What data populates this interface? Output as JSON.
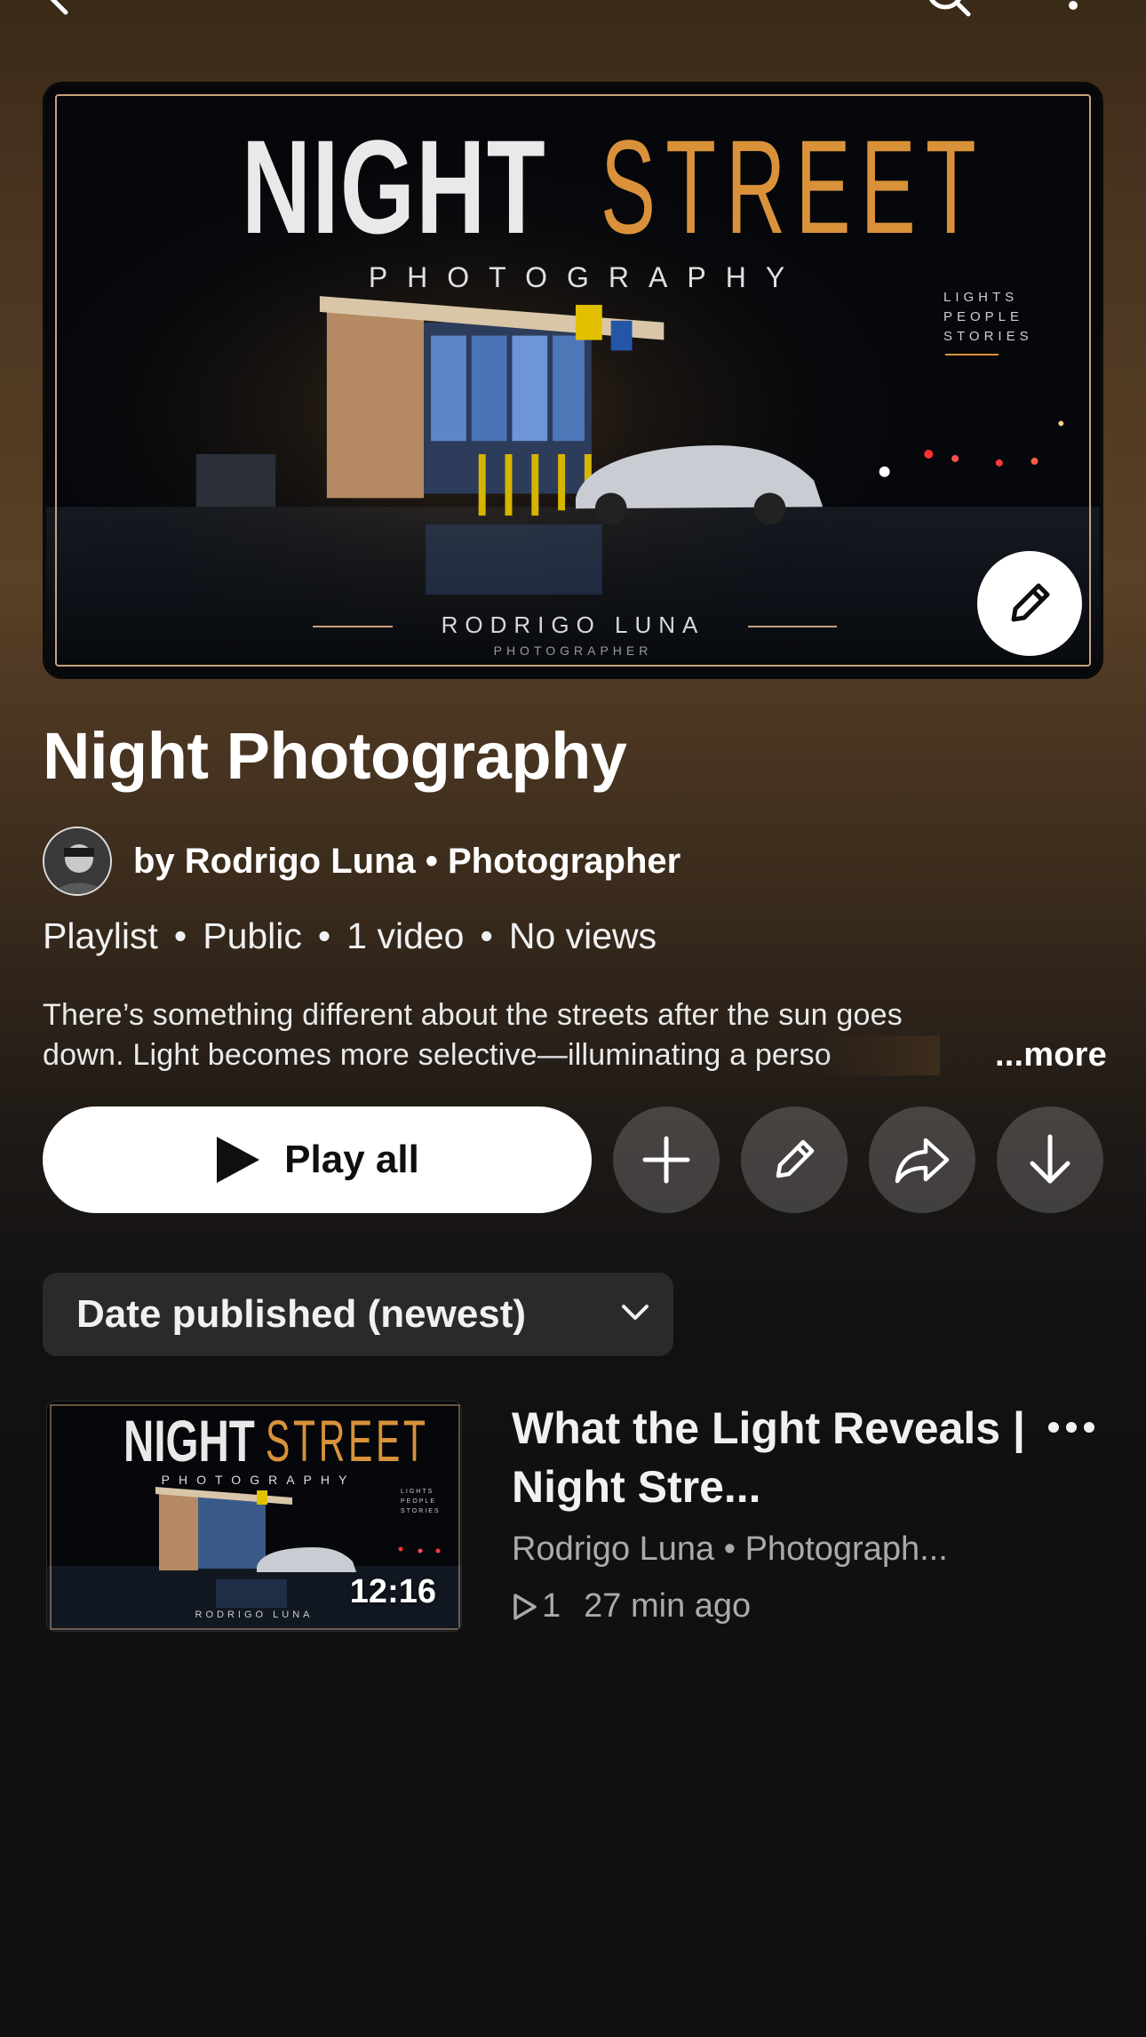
{
  "hero": {
    "title_part1": "NIGHT",
    "title_part2": "STREET",
    "subtitle": "PHOTOGRAPHY",
    "tagline": [
      "LIGHTS",
      "PEOPLE",
      "STORIES"
    ],
    "credit": "RODRIGO LUNA",
    "credit_sub": "PHOTOGRAPHER"
  },
  "playlist": {
    "title": "Night Photography",
    "owner": "by Rodrigo Luna • Photographer",
    "meta": [
      "Playlist",
      "Public",
      "1 video",
      "No views"
    ],
    "description_line1": "There’s something different about the streets after the sun goes",
    "description_line2": "down. Light becomes more selective—illuminating a perso",
    "more_label": "...more"
  },
  "actions": {
    "play_all": "Play all"
  },
  "sort": {
    "selected": "Date published (newest)"
  },
  "videos": [
    {
      "title": "What the Light Reveals | Night Stre...",
      "channel": "Rodrigo Luna • Photograph...",
      "views": "1",
      "age": "27 min ago",
      "duration": "12:16",
      "thumb_night": "NIGHT",
      "thumb_street": "STREET",
      "thumb_sub": "PHOTOGRAPHY",
      "thumb_tag": "LIGHTS PEOPLE STORIES",
      "thumb_credit": "RODRIGO LUNA"
    }
  ],
  "colors": {
    "accent_gold": "#d9923a",
    "background": "#0f0f0f",
    "chip": "#2a2a2a",
    "secondary_text": "#aaaaaa"
  },
  "icons": [
    "back-icon",
    "search-icon",
    "more-vert-icon",
    "edit-icon",
    "play-icon",
    "add-icon",
    "share-icon",
    "download-icon",
    "chevron-down-icon",
    "more-horiz-icon",
    "views-icon"
  ]
}
